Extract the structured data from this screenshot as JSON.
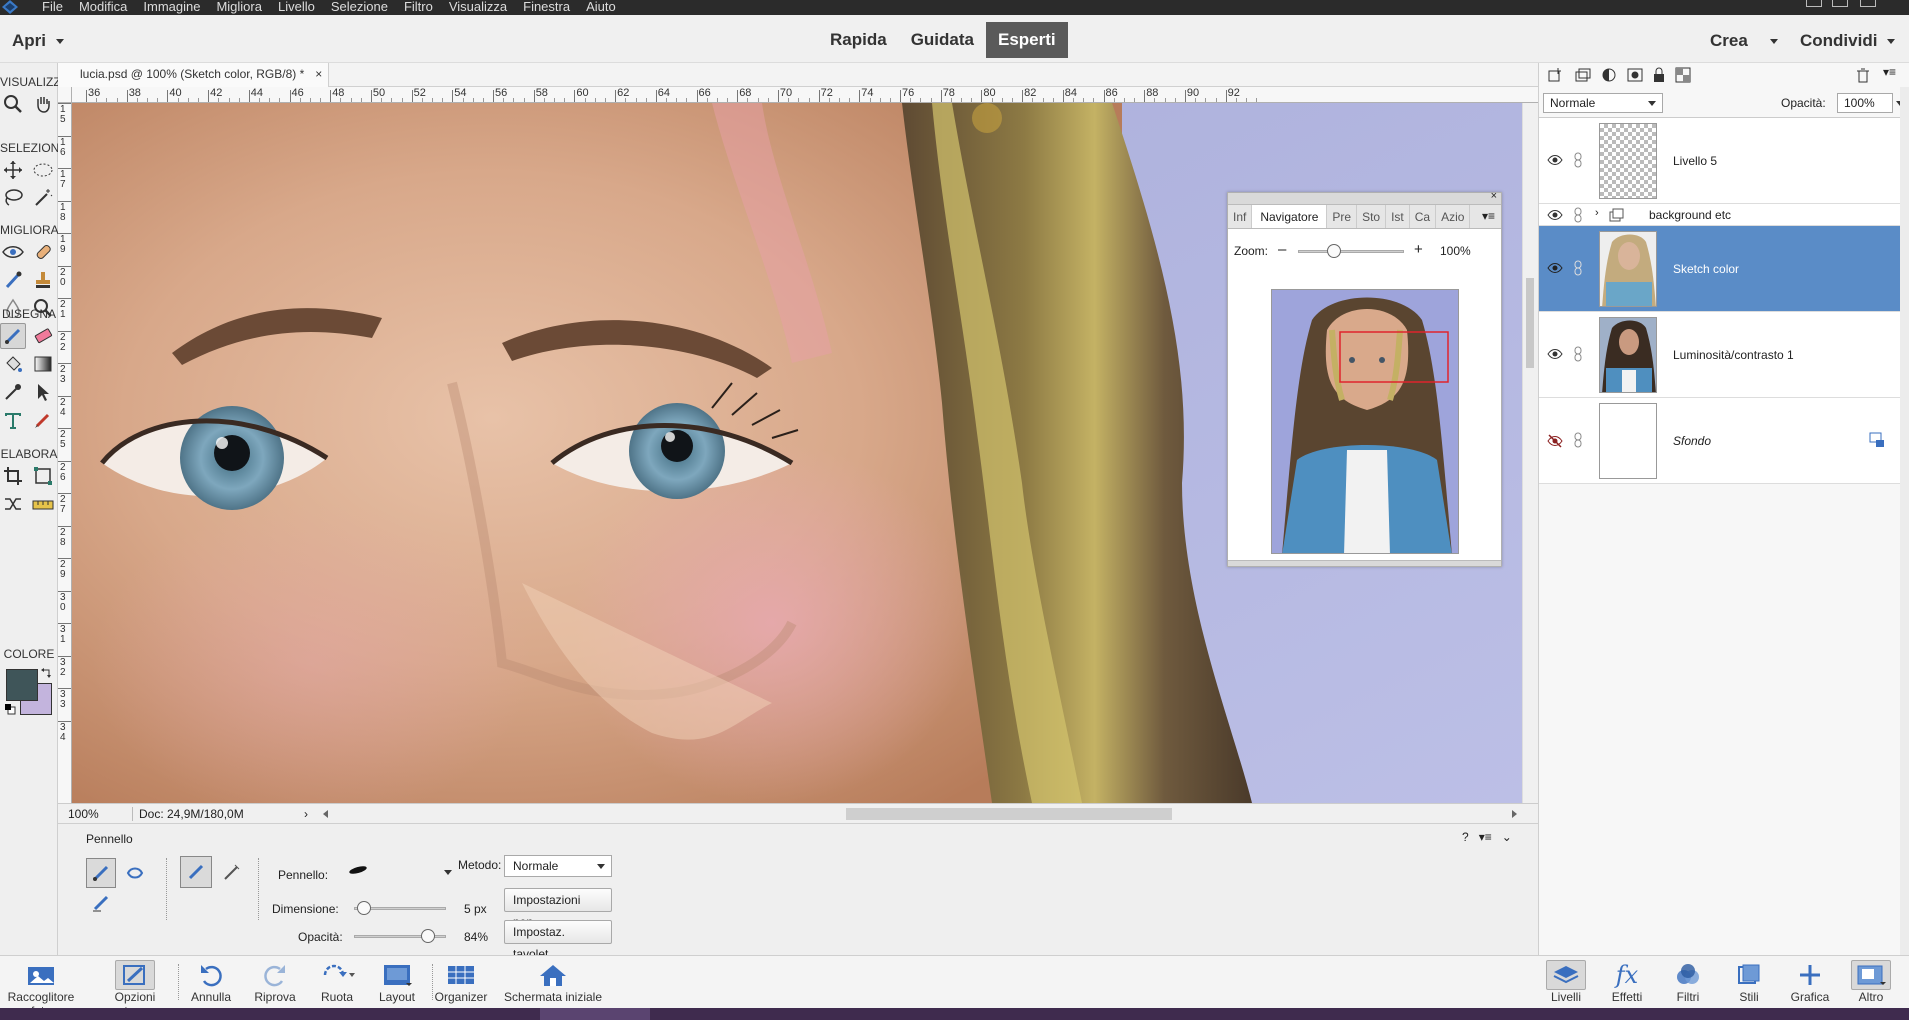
{
  "menu": [
    "File",
    "Modifica",
    "Immagine",
    "Migliora",
    "Livello",
    "Selezione",
    "Filtro",
    "Visualizza",
    "Finestra",
    "Aiuto"
  ],
  "modebar": {
    "open_label": "Apri",
    "modes": [
      "Rapida",
      "Guidata",
      "Esperti"
    ],
    "active_mode": "Esperti",
    "create_label": "Crea",
    "share_label": "Condividi"
  },
  "toolbox": {
    "sections": [
      "VISUALIZZA",
      "SELEZIONA",
      "MIGLIORA",
      "DISEGNA",
      "ELABORA",
      "COLORE"
    ],
    "foreground_color": "#3f5559",
    "background_color": "#c3b4dd"
  },
  "document": {
    "tab_title": "lucia.psd @ 100% (Sketch color, RGB/8) *",
    "ruler_h": [
      "36",
      "38",
      "40",
      "42",
      "44",
      "46",
      "48",
      "50",
      "52",
      "54",
      "56",
      "58",
      "60",
      "62",
      "64",
      "66",
      "68",
      "70",
      "72",
      "74",
      "76",
      "78",
      "80",
      "82",
      "84",
      "86",
      "88",
      "90",
      "92"
    ],
    "ruler_v": [
      "1\n5",
      "1\n6",
      "1\n7",
      "1\n8",
      "1\n9",
      "2\n0",
      "2\n1",
      "2\n2",
      "2\n3",
      "2\n4",
      "2\n5",
      "2\n6",
      "2\n7",
      "2\n8",
      "2\n9",
      "3\n0",
      "3\n1",
      "3\n2",
      "3\n3",
      "3\n4"
    ],
    "zoom": "100%",
    "doc_size": "Doc: 24,9M/180,0M"
  },
  "navigator": {
    "tabs": [
      "Inf",
      "Navigatore",
      "Pre",
      "Sto",
      "Ist",
      "Ca",
      "Azio"
    ],
    "active_tab": "Navigatore",
    "zoom_label": "Zoom:",
    "zoom_value": "100%",
    "zoom_fraction": 0.3
  },
  "options": {
    "tool_name": "Pennello",
    "brush_label": "Pennello:",
    "size_label": "Dimensione:",
    "size_value": "5 px",
    "size_fraction": 0.02,
    "opacity_label": "Opacità:",
    "opacity_value": "84%",
    "opacity_fraction": 0.84,
    "mode_label": "Metodo:",
    "mode_value": "Normale",
    "brush_settings_btn": "Impostazioni pen...",
    "tablet_settings_btn": "Impostaz. tavolet..."
  },
  "layers": {
    "blend_mode": "Normale",
    "opacity_label": "Opacità:",
    "opacity_value": "100%",
    "items": [
      {
        "name": "Livello 5",
        "type": "transparent",
        "visible": true
      },
      {
        "name": "background etc",
        "type": "group",
        "visible": true
      },
      {
        "name": "Sketch color",
        "type": "portrait",
        "visible": true,
        "selected": true
      },
      {
        "name": "Luminosità/contrasto 1",
        "type": "portrait",
        "visible": true
      },
      {
        "name": "Sfondo",
        "type": "white",
        "visible": false,
        "locked": true
      }
    ]
  },
  "bottombar": {
    "left": [
      {
        "label": "Raccoglitore foto",
        "icon": "photo-bin-icon"
      },
      {
        "label": "Opzioni strum.",
        "icon": "tool-options-icon"
      },
      {
        "label": "Annulla",
        "icon": "undo-icon"
      },
      {
        "label": "Riprova",
        "icon": "redo-icon"
      },
      {
        "label": "Ruota",
        "icon": "rotate-icon"
      },
      {
        "label": "Layout",
        "icon": "layout-icon"
      },
      {
        "label": "Organizer",
        "icon": "organizer-icon"
      },
      {
        "label": "Schermata iniziale",
        "icon": "home-icon"
      }
    ],
    "right": [
      {
        "label": "Livelli",
        "icon": "layers-icon"
      },
      {
        "label": "Effetti",
        "icon": "effects-icon"
      },
      {
        "label": "Filtri",
        "icon": "filters-icon"
      },
      {
        "label": "Stili",
        "icon": "styles-icon"
      },
      {
        "label": "Grafica",
        "icon": "graphics-icon"
      },
      {
        "label": "Altro",
        "icon": "more-icon"
      }
    ]
  }
}
